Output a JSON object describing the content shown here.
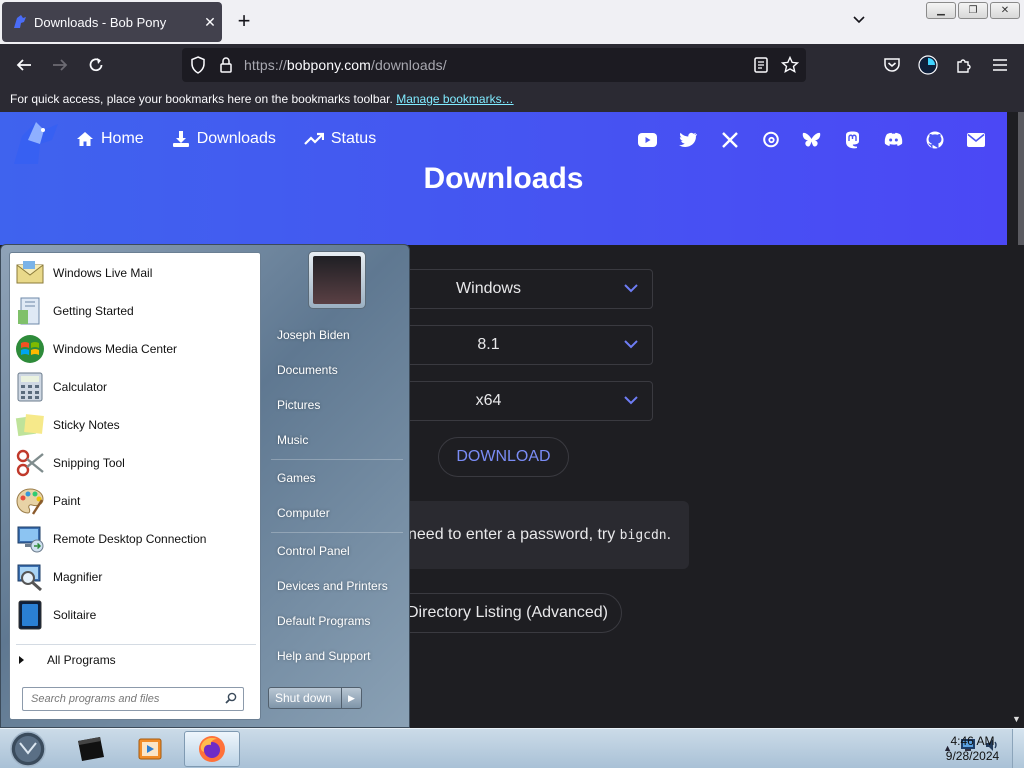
{
  "browser": {
    "tab_title": "Downloads - Bob Pony",
    "tab_close": "✕",
    "new_tab": "+",
    "url_prefix": "https://",
    "url_host": "bobpony.com",
    "url_path": "/downloads/",
    "bookmark_bar_text": "For quick access, place your bookmarks here on the bookmarks toolbar.",
    "manage_bookmarks": "Manage bookmarks…"
  },
  "site": {
    "nav": [
      {
        "label": "Home",
        "icon": "home-icon"
      },
      {
        "label": "Downloads",
        "icon": "download-icon"
      },
      {
        "label": "Status",
        "icon": "trending-up-icon"
      }
    ],
    "social": [
      "youtube-icon",
      "twitter-icon",
      "x-icon",
      "threads-icon",
      "bluesky-icon",
      "mastodon-icon",
      "discord-icon",
      "github-icon",
      "mail-icon"
    ],
    "title": "Downloads",
    "selects": [
      {
        "value": "Windows"
      },
      {
        "value": "8.1"
      },
      {
        "value": "x64"
      }
    ],
    "download_button": "DOWNLOAD",
    "note_text": "need to enter a password, try ",
    "note_code": "bigcdn",
    "note_end": ".",
    "directory_button": "Directory Listing (Advanced)"
  },
  "start_menu": {
    "programs": [
      {
        "label": "Windows Live Mail",
        "icon": "mail-icon"
      },
      {
        "label": "Getting Started",
        "icon": "getting-started-icon"
      },
      {
        "label": "Windows Media Center",
        "icon": "media-center-icon"
      },
      {
        "label": "Calculator",
        "icon": "calculator-icon"
      },
      {
        "label": "Sticky Notes",
        "icon": "sticky-notes-icon"
      },
      {
        "label": "Snipping Tool",
        "icon": "scissors-icon"
      },
      {
        "label": "Paint",
        "icon": "paint-palette-icon"
      },
      {
        "label": "Remote Desktop Connection",
        "icon": "remote-desktop-icon"
      },
      {
        "label": "Magnifier",
        "icon": "magnifier-icon"
      },
      {
        "label": "Solitaire",
        "icon": "solitaire-icon"
      }
    ],
    "all_programs": "All Programs",
    "search_placeholder": "Search programs and files",
    "right_links": [
      "Joseph Biden",
      "Documents",
      "Pictures",
      "Music",
      "Games",
      "Computer",
      "Control Panel",
      "Devices and Printers",
      "Default Programs",
      "Help and Support"
    ],
    "shutdown": "Shut down"
  },
  "taskbar": {
    "time": "4:46 AM",
    "date": "9/28/2024"
  }
}
